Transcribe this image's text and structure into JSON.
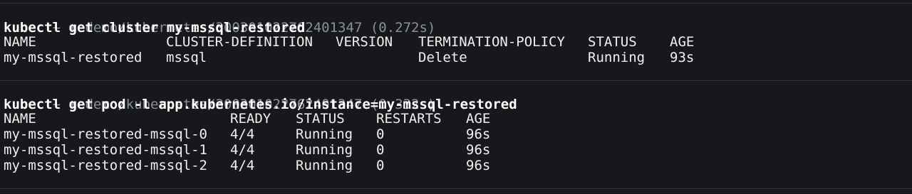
{
  "blocks": [
    {
      "prompt": {
        "symbol": "~",
        "icon": "helm-wheel-icon",
        "path": "demo/kubernetes/300301022762401347",
        "duration": "(0.272s)"
      },
      "command": "kubectl get cluster my-mssql-restored",
      "headers": [
        "NAME",
        "CLUSTER-DEFINITION",
        "VERSION",
        "TERMINATION-POLICY",
        "STATUS",
        "AGE"
      ],
      "rows": [
        [
          "my-mssql-restored",
          "mssql",
          "",
          "Delete",
          "Running",
          "93s"
        ]
      ]
    },
    {
      "prompt": {
        "symbol": "~",
        "icon": "helm-wheel-icon",
        "path": "demo/kubernetes/300301022762401347",
        "duration": "(0.332s)"
      },
      "command": "kubectl get pod -l app.kubernetes.io/instance=my-mssql-restored",
      "headers": [
        "NAME",
        "READY",
        "STATUS",
        "RESTARTS",
        "AGE"
      ],
      "rows": [
        [
          "my-mssql-restored-mssql-0",
          "4/4",
          "Running",
          "0",
          "96s"
        ],
        [
          "my-mssql-restored-mssql-1",
          "4/4",
          "Running",
          "0",
          "96s"
        ],
        [
          "my-mssql-restored-mssql-2",
          "4/4",
          "Running",
          "0",
          "96s"
        ]
      ]
    }
  ],
  "colors": {
    "background": "#17181b",
    "text": "#f0f0f0",
    "prompt": "#8b8f98",
    "separator": "#34363b"
  }
}
